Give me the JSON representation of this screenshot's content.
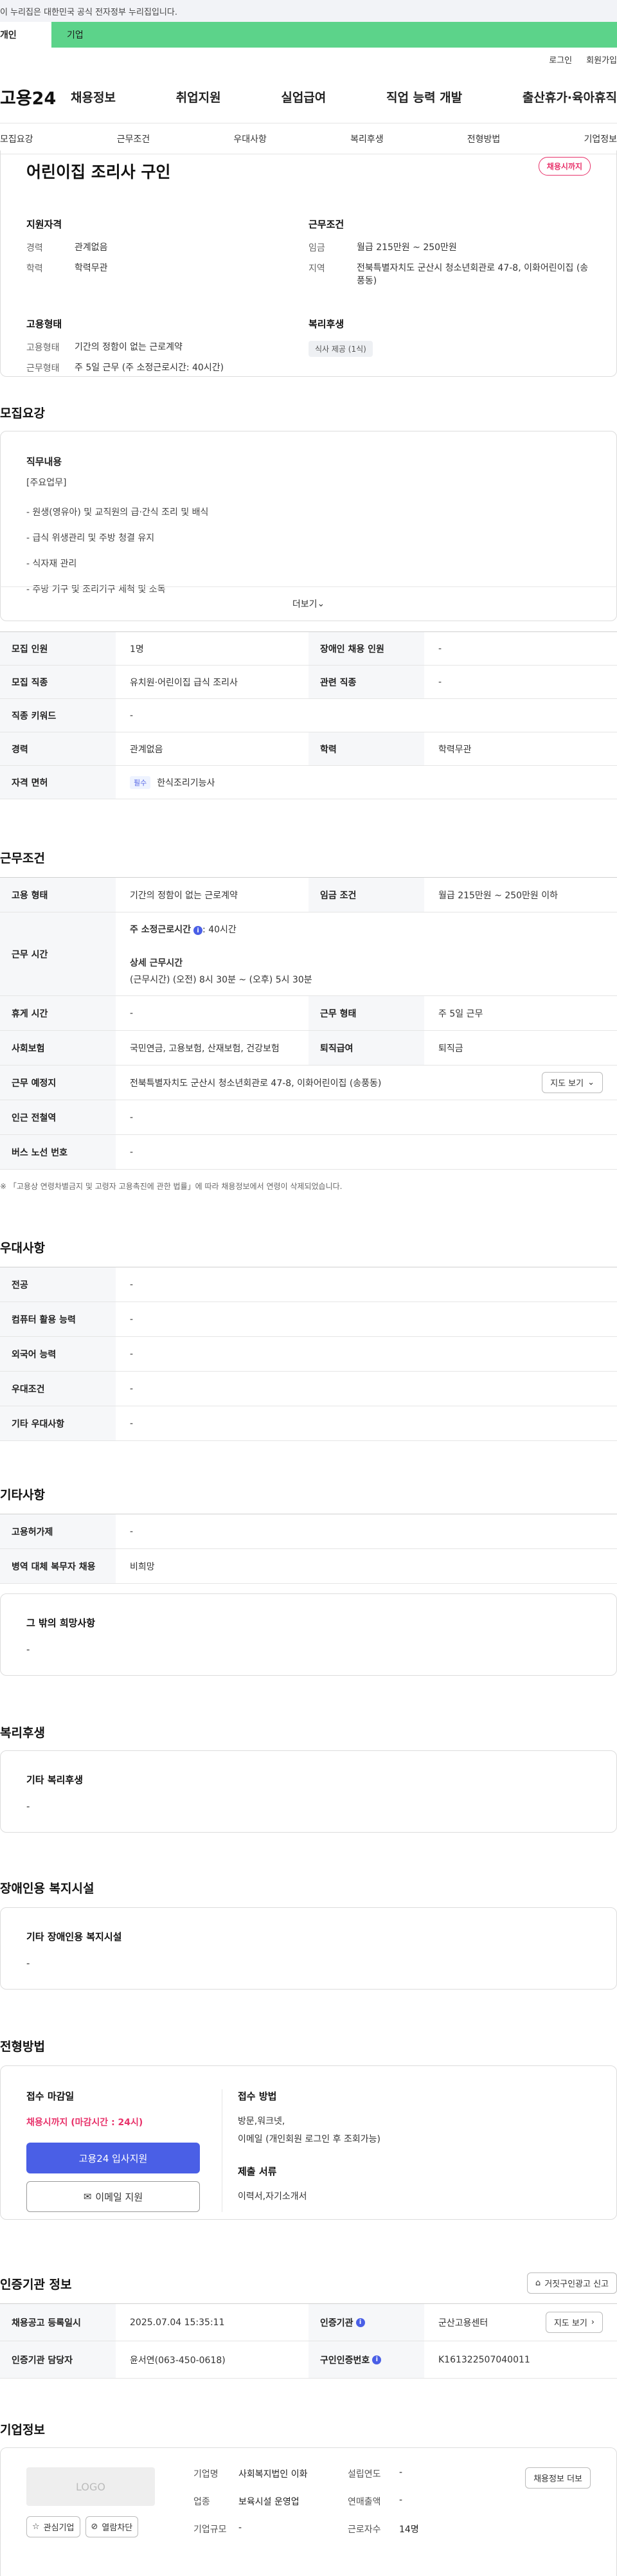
{
  "gov_bar": {
    "text": "이 누리집은 대한민국 공식 전자정부 누리집입니다."
  },
  "top_tabs": {
    "individual": "개인",
    "business": "기업"
  },
  "util": {
    "login": "로그인",
    "signup": "회원가입"
  },
  "gnb": {
    "logo": "고용24",
    "menu": [
      "채용정보",
      "취업지원",
      "실업급여",
      "직업 능력 개발",
      "출산휴가·육아휴직"
    ]
  },
  "subnav": [
    "모집요강",
    "근무조건",
    "우대사항",
    "복리후생",
    "전형방법",
    "기업정보"
  ],
  "hero": {
    "title": "어린이집 조리사 구인",
    "badge": "채용시까지",
    "qual": {
      "title": "지원자격",
      "career_k": "경력",
      "career_v": "관계없음",
      "edu_k": "학력",
      "edu_v": "학력무관"
    },
    "work": {
      "title": "근무조건",
      "wage_k": "임금",
      "wage_v": "월급 215만원 ~ 250만원",
      "loc_k": "지역",
      "loc_v": "전북특별자치도 군산시 청소년회관로 47-8, 이화어린이집 (송풍동)"
    },
    "emp": {
      "title": "고용형태",
      "type_k": "고용형태",
      "type_v": "기간의 정함이 없는 근로계약",
      "hour_k": "근무형태",
      "hour_v": "주 5일 근무 (주 소정근로시간: 40시간)"
    },
    "welfare": {
      "title": "복리후생",
      "chip": "식사 제공 (1식)"
    }
  },
  "duty": {
    "section": "모집요강",
    "title": "직무내용",
    "lines": [
      "[주요업무]",
      "- 원생(영유아) 및 교직원의 급·간식 조리 및 배식",
      "- 급식 위생관리 및 주방 청결 유지",
      "- 식자재 관리",
      "- 주방 기구 및 조리기구 세척 및 소독"
    ],
    "more": "더보기"
  },
  "recruit": {
    "count_k": "모집 인원",
    "count_v": "1명",
    "disabled_k": "장애인 채용 인원",
    "disabled_v": "-",
    "job_k": "모집 직종",
    "job_v": "유치원·어린이집 급식 조리사",
    "rel_k": "관련 직종",
    "rel_v": "-",
    "kw_k": "직종 키워드",
    "kw_v": "-",
    "career_k": "경력",
    "career_v": "관계없음",
    "edu_k": "학력",
    "edu_v": "학력무관",
    "lic_k": "자격 면허",
    "lic_tag": "필수",
    "lic_v": "한식조리기능사"
  },
  "cond": {
    "section": "근무조건",
    "type_k": "고용 형태",
    "type_v": "기간의 정함이 없는 근로계약",
    "wage_k": "임금 조건",
    "wage_v": "월급 215만원 ~ 250만원 이하",
    "time_k": "근무 시간",
    "time_main": "주 소정근로시간",
    "time_main_v": ": 40시간",
    "time_detail_t": "상세 근무시간",
    "time_detail_v": "(근무시간) (오전) 8시 30분 ~ (오후) 5시 30분",
    "rest_k": "휴게 시간",
    "rest_v": "-",
    "shape_k": "근무 형태",
    "shape_v": "주 5일 근무",
    "ins_k": "사회보험",
    "ins_v": "국민연금, 고용보험, 산재보험, 건강보험",
    "sev_k": "퇴직급여",
    "sev_v": "퇴직금",
    "place_k": "근무 예정지",
    "place_v": "전북특별자치도 군산시 청소년회관로 47-8, 이화어린이집 (송풍동)",
    "map_btn": "지도 보기",
    "sub_k": "인근 전철역",
    "sub_v": "-",
    "bus_k": "버스 노선 번호",
    "bus_v": "-",
    "note": "※ 「고용상 연령차별금지 및 고령자 고용촉진에 관한 법률」에 따라 채용정보에서 연령이 삭제되었습니다."
  },
  "pref": {
    "section": "우대사항",
    "rows": [
      {
        "k": "전공",
        "v": "-"
      },
      {
        "k": "컴퓨터 활용 능력",
        "v": "-"
      },
      {
        "k": "외국어 능력",
        "v": "-"
      },
      {
        "k": "우대조건",
        "v": "-"
      },
      {
        "k": "기타 우대사항",
        "v": "-"
      }
    ]
  },
  "etc": {
    "section": "기타사항",
    "rows": [
      {
        "k": "고용허가제",
        "v": "-"
      },
      {
        "k": "병역 대체 복무자 채용",
        "v": "비희망"
      }
    ],
    "box_h": "그 밖의 희망사항",
    "box_d": "-"
  },
  "welfare": {
    "section": "복리후생",
    "box_h": "기타 복리후생",
    "box_d": "-"
  },
  "disab": {
    "section": "장애인용 복지시설",
    "box_h": "기타 장애인용 복지시설",
    "box_d": "-"
  },
  "apply": {
    "section": "전형방법",
    "deadline_h": "접수 마감일",
    "deadline_v": "채용시까지 (마감시간 : 24시)",
    "btn_primary": "고용24 입사지원",
    "btn_email": "이메일 지원",
    "method_h": "접수 방법",
    "method_v1": "방문,워크넷,",
    "method_v2": "이메일 (개인회원 로그인 후 조회가능)",
    "docs_h": "제출 서류",
    "docs_v": "이력서,자기소개서"
  },
  "agency": {
    "section": "인증기관 정보",
    "report_btn": "거짓구인광고 신고",
    "reg_k": "채용공고 등록일시",
    "reg_v": "2025.07.04 15:35:11",
    "org_k": "인증기관",
    "org_v": "군산고용센터",
    "map_btn": "지도 보기",
    "mgr_k": "인증기관 담당자",
    "mgr_v": "윤서연(063-450-0618)",
    "no_k": "구인인증번호",
    "no_v": "K161322507040011"
  },
  "company": {
    "section": "기업정보",
    "logo": "LOGO",
    "fav": "관심기업",
    "block": "열람차단",
    "more_btn": "채용정보 더보",
    "name_k": "기업명",
    "name_v": "사회복지법인 이화",
    "year_k": "설립연도",
    "year_v": "-",
    "ind_k": "업종",
    "ind_v": "보육시설 운영업",
    "sales_k": "연매출액",
    "sales_v": "-",
    "size_k": "기업규모",
    "size_v": "-",
    "emp_k": "근로자수",
    "emp_v": "14명"
  },
  "colors": {
    "accent": "#4a5fe6",
    "badge": "#e8336b",
    "biz_tab": "#5cd38a"
  }
}
